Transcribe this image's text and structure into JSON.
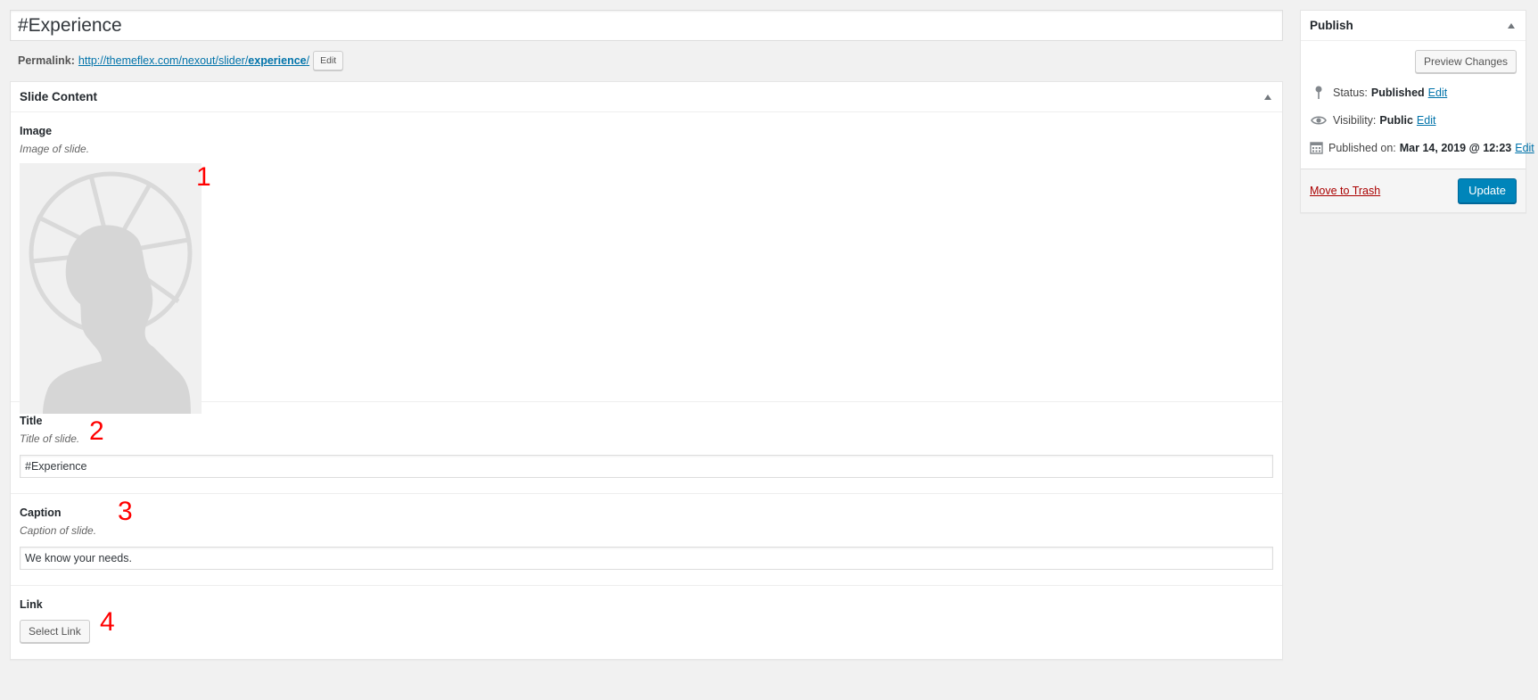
{
  "post": {
    "title": "#Experience",
    "permalink_label": "Permalink:",
    "permalink_base": "http://themeflex.com/nexout/slider/",
    "permalink_slug": "experience",
    "permalink_trail": "/",
    "permalink_edit": "Edit"
  },
  "slide_content": {
    "heading": "Slide Content",
    "image": {
      "label": "Image",
      "desc": "Image of slide.",
      "annotation": "1"
    },
    "title": {
      "label": "Title",
      "desc": "Title of slide.",
      "value": "#Experience",
      "annotation": "2"
    },
    "caption": {
      "label": "Caption",
      "desc": "Caption of slide.",
      "value": "We know your needs.",
      "annotation": "3"
    },
    "link": {
      "label": "Link",
      "button": "Select Link",
      "annotation": "4"
    }
  },
  "publish": {
    "heading": "Publish",
    "preview_button": "Preview Changes",
    "status_label": "Status:",
    "status_value": "Published",
    "visibility_label": "Visibility:",
    "visibility_value": "Public",
    "published_label": "Published on:",
    "published_value": "Mar 14, 2019 @ 12:23",
    "edit_label": "Edit",
    "trash_label": "Move to Trash",
    "update_button": "Update"
  },
  "icons": {
    "status": "pin-icon",
    "visibility": "eye-icon",
    "published": "calendar-icon",
    "collapse": "triangle-up-icon"
  },
  "colors": {
    "link": "#0073aa",
    "primary": "#0085ba",
    "trash": "#aa0000",
    "annotation": "#ff0000",
    "background": "#f1f1f1"
  }
}
